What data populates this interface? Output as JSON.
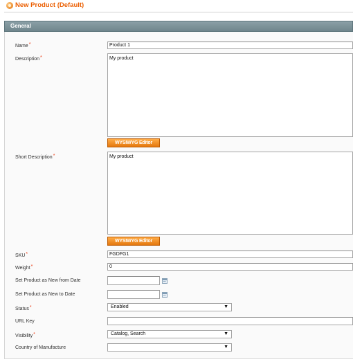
{
  "header": {
    "title": "New Product (Default)",
    "icon": "product-icon"
  },
  "section": {
    "title": "General"
  },
  "fields": {
    "name": {
      "label": "Name",
      "value": "Product 1",
      "required": "*"
    },
    "description": {
      "label": "Description",
      "value": "My product",
      "required": "*",
      "editor_button": "WYSIWYG Editor"
    },
    "short_description": {
      "label": "Short Description",
      "value": "My product",
      "required": "*",
      "editor_button": "WYSIWYG Editor"
    },
    "sku": {
      "label": "SKU",
      "value": "FGDFG1",
      "required": "*"
    },
    "weight": {
      "label": "Weight",
      "value": "0",
      "required": "*"
    },
    "new_from_date": {
      "label": "Set Product as New from Date",
      "value": ""
    },
    "new_to_date": {
      "label": "Set Product as New to Date",
      "value": ""
    },
    "status": {
      "label": "Status",
      "value": "Enabled",
      "required": "*"
    },
    "url_key": {
      "label": "URL Key",
      "value": ""
    },
    "visibility": {
      "label": "Visibility",
      "value": "Catalog, Search",
      "required": "*"
    },
    "country": {
      "label": "Country of Manufacture",
      "value": ""
    }
  },
  "dropdown_arrow": "▼",
  "colors": {
    "accent": "#eb5e00",
    "required": "#eb340a",
    "section_bar": "#7b9097",
    "button": "#f18a24"
  }
}
